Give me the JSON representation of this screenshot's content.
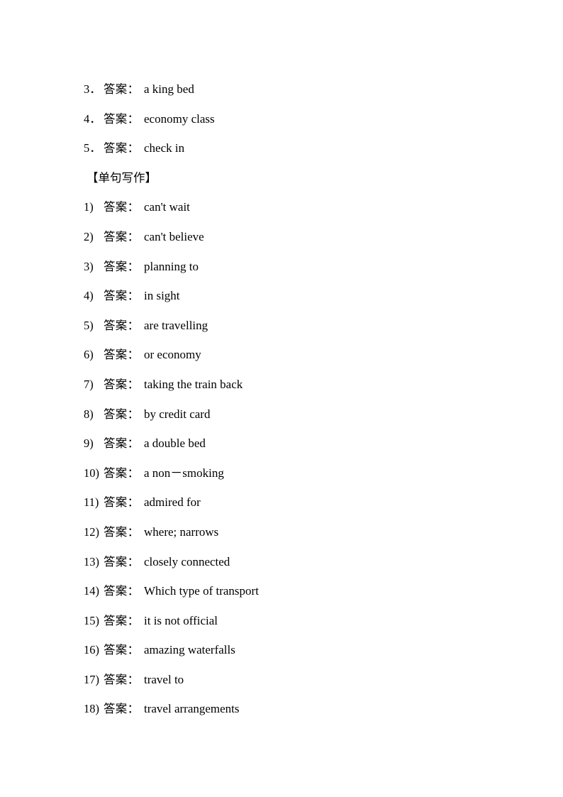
{
  "document": {
    "answer_label": "答案",
    "colon": "：",
    "section_heading": "【单句写作】"
  },
  "top_items": [
    {
      "number": "3．",
      "answer_label": "答案",
      "colon": "：",
      "value": "a king bed"
    },
    {
      "number": "4．",
      "answer_label": "答案",
      "colon": "：",
      "value": "economy class"
    },
    {
      "number": "5．",
      "answer_label": "答案",
      "colon": "：",
      "value": "check in"
    }
  ],
  "writing_items": [
    {
      "number": "1)",
      "answer_label": "答案",
      "colon": "：",
      "value": "can't wait"
    },
    {
      "number": "2)",
      "answer_label": "答案",
      "colon": "：",
      "value": "can't believe"
    },
    {
      "number": "3)",
      "answer_label": "答案",
      "colon": "：",
      "value": "planning to"
    },
    {
      "number": "4)",
      "answer_label": "答案",
      "colon": "：",
      "value": "in sight"
    },
    {
      "number": "5)",
      "answer_label": "答案",
      "colon": "：",
      "value": "are travelling"
    },
    {
      "number": "6)",
      "answer_label": "答案",
      "colon": "：",
      "value": "or economy"
    },
    {
      "number": "7)",
      "answer_label": "答案",
      "colon": "：",
      "value": "taking the train back"
    },
    {
      "number": "8)",
      "answer_label": "答案",
      "colon": "：",
      "value": "by credit card"
    },
    {
      "number": "9)",
      "answer_label": "答案",
      "colon": "：",
      "value": "a double bed"
    },
    {
      "number": "10)",
      "answer_label": "答案",
      "colon": "：",
      "value": "a non－smoking"
    },
    {
      "number": "11)",
      "answer_label": "答案",
      "colon": "：",
      "value": "admired for"
    },
    {
      "number": "12)",
      "answer_label": "答案",
      "colon": "：",
      "value": "where; narrows"
    },
    {
      "number": "13)",
      "answer_label": "答案",
      "colon": "：",
      "value": "closely connected"
    },
    {
      "number": "14)",
      "answer_label": "答案",
      "colon": "：",
      "value": "Which type of transport"
    },
    {
      "number": "15)",
      "answer_label": "答案",
      "colon": "：",
      "value": "it is not official"
    },
    {
      "number": "16)",
      "answer_label": "答案",
      "colon": "：",
      "value": "amazing waterfalls"
    },
    {
      "number": "17)",
      "answer_label": "答案",
      "colon": "：",
      "value": "travel to"
    },
    {
      "number": "18)",
      "answer_label": "答案",
      "colon": "：",
      "value": "travel arrangements"
    }
  ],
  "style": {
    "page_background": "#ffffff",
    "text_color": "#000000"
  }
}
